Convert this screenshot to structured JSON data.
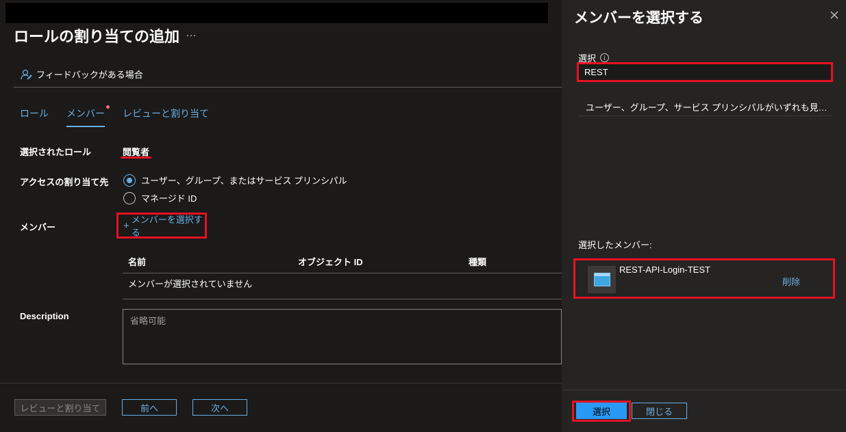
{
  "left": {
    "title": "ロールの割り当ての追加",
    "title_more": "…",
    "feedback": "フィードバックがある場合",
    "tabs": [
      {
        "label": "ロール"
      },
      {
        "label": "メンバー"
      },
      {
        "label": "レビューと割り当て"
      }
    ],
    "selected_role_label": "選択されたロール",
    "selected_role_value": "閲覧者",
    "access_label": "アクセスの割り当て先",
    "access_options": [
      {
        "label": "ユーザー、グループ、またはサービス プリンシパル",
        "checked": true
      },
      {
        "label": "マネージド ID",
        "checked": false
      }
    ],
    "members_label": "メンバー",
    "select_members": "メンバーを選択する",
    "grid": {
      "headers": [
        "名前",
        "オブジェクト ID",
        "種類"
      ],
      "empty": "メンバーが選択されていません"
    },
    "description_label": "Description",
    "description_placeholder": "省略可能",
    "footer": {
      "review": "レビューと割り当て",
      "prev": "前へ",
      "next": "次へ"
    }
  },
  "panel": {
    "title": "メンバーを選択する",
    "select_label": "選択",
    "search_value": "REST",
    "no_result": "ユーザー、グループ、サービス プリンシパルがいずれも見つかりませんでした。",
    "selected_label": "選択したメンバー:",
    "member": {
      "name": "REST-API-Login-TEST",
      "remove": "削除"
    },
    "footer": {
      "select": "選択",
      "close": "閉じる"
    }
  },
  "colors": {
    "accent": "#69afe5",
    "primary": "#2899f5",
    "highlight": "#e81123",
    "background": "#1b1a19"
  }
}
